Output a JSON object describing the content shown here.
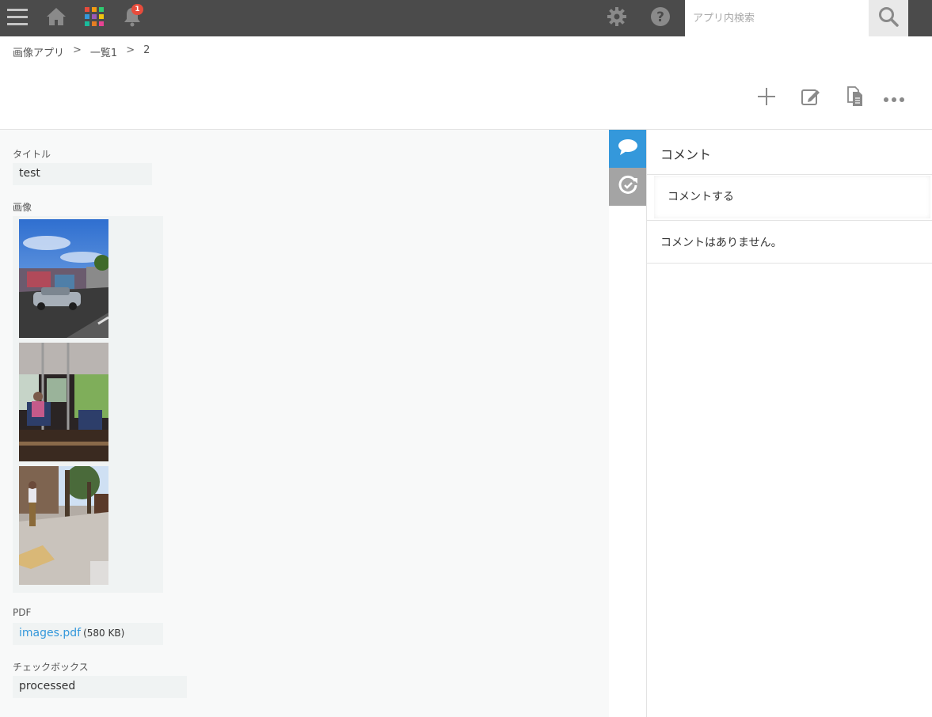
{
  "header": {
    "icons": [
      "menu-icon",
      "home-icon",
      "apps-grid-icon",
      "bell-icon",
      "gear-icon",
      "help-icon",
      "search-icon"
    ],
    "notification_count": "1",
    "search": {
      "placeholder": "アプリ内検索",
      "value": ""
    }
  },
  "breadcrumb": {
    "items": [
      "画像アプリ",
      "一覧1"
    ],
    "separator": ">",
    "current": "2"
  },
  "toolbar": {
    "icons": [
      "add-icon",
      "edit-icon",
      "duplicate-icon",
      "more-icon"
    ]
  },
  "record": {
    "title": {
      "label": "タイトル",
      "value": "test"
    },
    "image": {
      "label": "画像",
      "count": 3
    },
    "pdf": {
      "label": "PDF",
      "file_name": "images.pdf",
      "file_size": "(580 KB)"
    },
    "checkbox": {
      "label": "チェックボックス",
      "value": "processed"
    }
  },
  "side_tabs": [
    "comment-icon",
    "history-icon"
  ],
  "comments": {
    "title": "コメント",
    "input_placeholder": "コメントする",
    "empty_message": "コメントはありません。"
  },
  "colors": {
    "header_bg": "#4b4b4b",
    "accent": "#3498db",
    "badge": "#e74c3c",
    "history_tab": "#a4a4a4",
    "detail_bg": "#f8f9f9"
  }
}
